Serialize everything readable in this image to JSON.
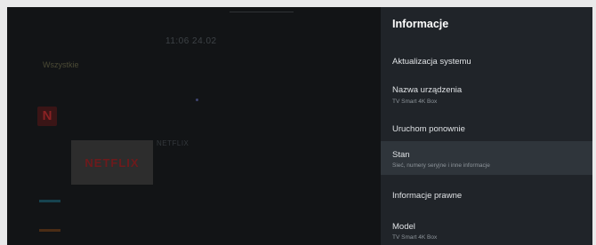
{
  "background": {
    "clock": "11:06 24.02",
    "tabs": [
      "Wszystkie",
      "",
      "",
      "",
      "",
      "",
      "",
      ""
    ],
    "netflix_logo": "NETFLIX",
    "netflix_icon_letter": "N",
    "netflix_title": "NETFLIX",
    "netflix_desc": ""
  },
  "settings_panel": {
    "title": "Informacje",
    "items": [
      {
        "label": "Aktualizacja systemu",
        "sublabel": ""
      },
      {
        "label": "Nazwa urządzenia",
        "sublabel": "TV Smart 4K Box"
      },
      {
        "label": "Uruchom ponownie",
        "sublabel": ""
      },
      {
        "label": "Stan",
        "sublabel": "Sieć, numery seryjne i inne informacje"
      },
      {
        "label": "Informacje prawne",
        "sublabel": ""
      },
      {
        "label": "Model",
        "sublabel": "TV Smart 4K Box"
      }
    ]
  },
  "colors": {
    "panel_bg": "#202429",
    "selected_bg": "#2f353b",
    "screen_bg": "#121416"
  }
}
